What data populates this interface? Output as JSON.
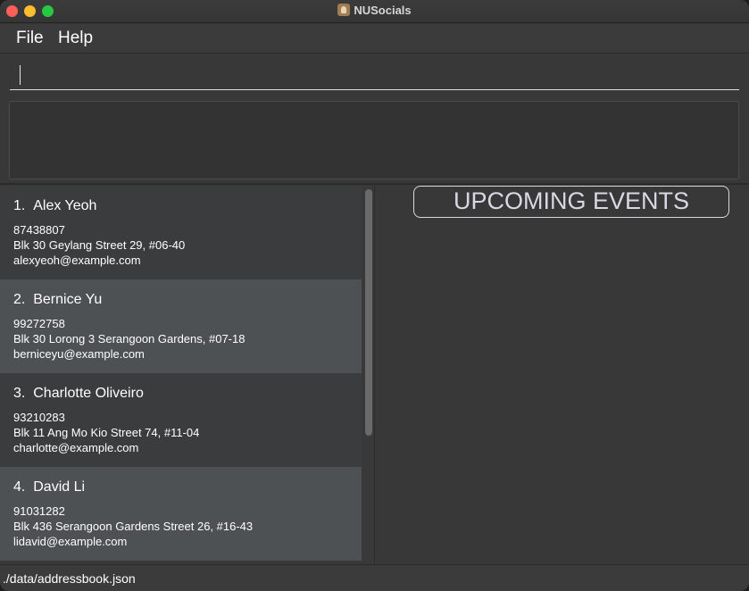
{
  "window": {
    "title": "NUSocials"
  },
  "menu": {
    "file": "File",
    "help": "Help"
  },
  "command": {
    "value": "",
    "placeholder": ""
  },
  "result": {
    "text": ""
  },
  "persons": [
    {
      "index": "1.",
      "name": "Alex Yeoh",
      "phone": "87438807",
      "address": "Blk 30 Geylang Street 29, #06-40",
      "email": "alexyeoh@example.com"
    },
    {
      "index": "2.",
      "name": "Bernice Yu",
      "phone": "99272758",
      "address": "Blk 30 Lorong 3 Serangoon Gardens, #07-18",
      "email": "berniceyu@example.com"
    },
    {
      "index": "3.",
      "name": "Charlotte Oliveiro",
      "phone": "93210283",
      "address": "Blk 11 Ang Mo Kio Street 74, #11-04",
      "email": "charlotte@example.com"
    },
    {
      "index": "4.",
      "name": "David Li",
      "phone": "91031282",
      "address": "Blk 436 Serangoon Gardens Street 26, #16-43",
      "email": "lidavid@example.com"
    }
  ],
  "events": {
    "header": "UPCOMING EVENTS"
  },
  "status": {
    "path": "./data/addressbook.json"
  },
  "colors": {
    "background": "#383838",
    "selected_card": "#4d5153",
    "card": "#3b3c3d",
    "events_header": "#d8d8e4"
  }
}
